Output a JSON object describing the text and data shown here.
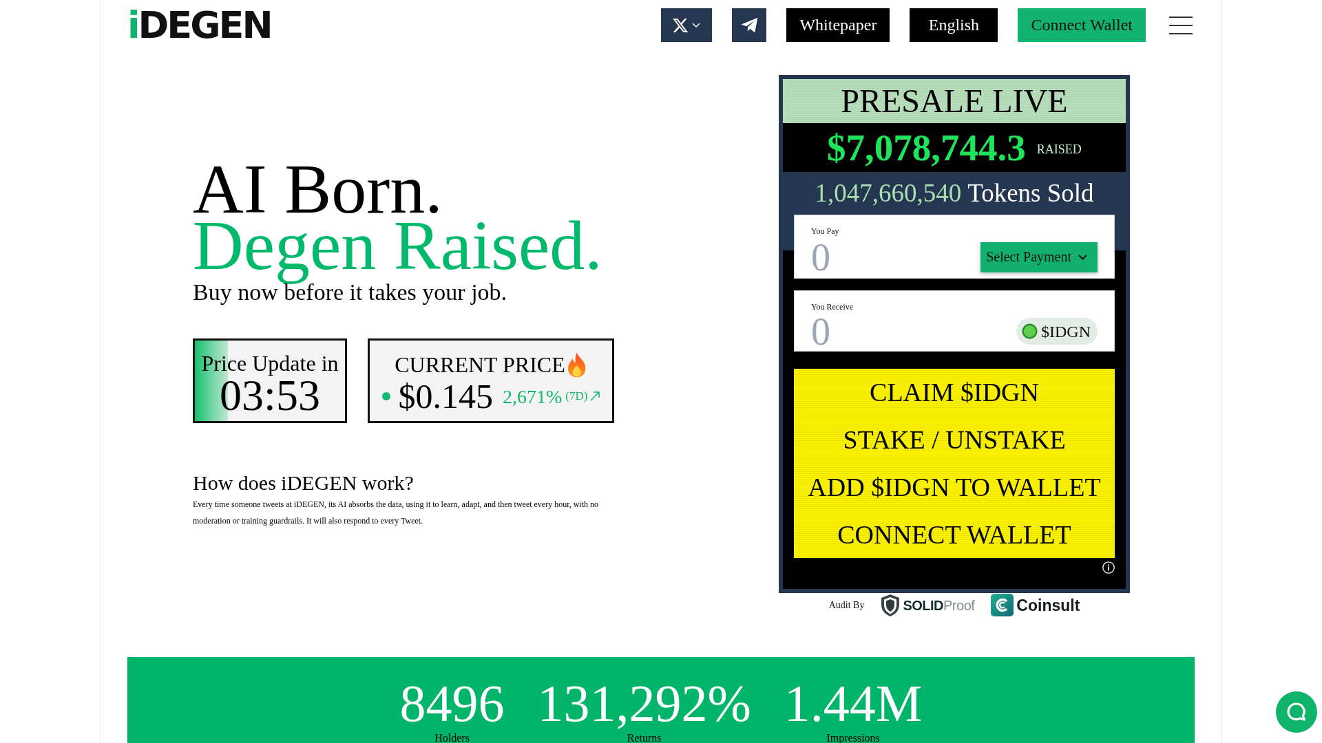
{
  "header": {
    "logo": {
      "accent": "i",
      "rest": "DEGEN"
    },
    "nav": [
      {
        "label": "Whitepaper",
        "kind": "dark"
      },
      {
        "label": "English",
        "kind": "dark"
      },
      {
        "label": "Connect Wallet",
        "kind": "primary"
      }
    ]
  },
  "hero": {
    "headline": "AI Born.",
    "headline_accent": "Degen Raised.",
    "tagline": "Buy now before it takes your job."
  },
  "price_update": {
    "label": "Price Update in",
    "countdown": "03:53",
    "level": 0.22
  },
  "current_price": {
    "label": "CURRENT PRICE",
    "price": "$0.145",
    "change": "2,671%",
    "period": "(7D)"
  },
  "how_it_works": {
    "title": "How does iDEGEN work?",
    "body": "Every time someone tweets at iDEGEN, its AI absorbs the data, using it to learn, adapt, and then tweet every hour, with no moderation or training guardrails. It will also respond to every Tweet."
  },
  "presale": {
    "title": "PRESALE LIVE",
    "raised_amount": "$7,078,744.3",
    "raised_label": "RAISED",
    "tokens_sold": "1,047,660,540",
    "tokens_label": "Tokens Sold",
    "pay": {
      "label": "You Pay",
      "placeholder": "0",
      "button": "Select Payment"
    },
    "receive": {
      "label": "You Receive",
      "placeholder": "0",
      "token": "$IDGN"
    },
    "actions": [
      "CLAIM $IDGN",
      "STAKE / UNSTAKE",
      "ADD $IDGN TO WALLET",
      "CONNECT WALLET"
    ]
  },
  "audit": {
    "label": "Audit By",
    "auditors": [
      {
        "kind": "shield",
        "name": "**SOLID**Proof"
      },
      {
        "kind": "tile",
        "name": "Coinsult"
      }
    ]
  },
  "stats": [
    {
      "value": "8496",
      "label": "Holders"
    },
    {
      "value": "131,292%",
      "label": "Returns"
    },
    {
      "value": "1.44M",
      "label": "Impressions"
    }
  ]
}
